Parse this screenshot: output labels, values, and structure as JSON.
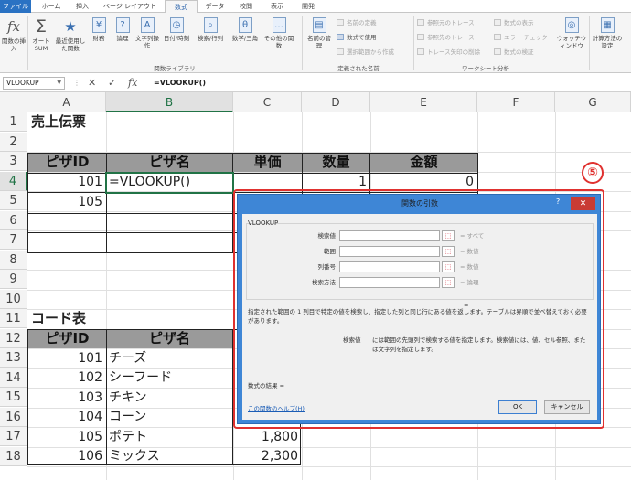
{
  "ribbon": {
    "tabs": [
      "ファイル",
      "ホーム",
      "挿入",
      "ページ レイアウト",
      "数式",
      "データ",
      "校閲",
      "表示",
      "開発"
    ],
    "active_tab": "数式",
    "buttons": {
      "insert_function": "関数の挿入",
      "autosum": "オート SUM",
      "recent": "最近使用した関数",
      "financial": "財務",
      "logical": "論理",
      "text": "文字列操作",
      "datetime": "日付/時刻",
      "lookup": "検索/行列",
      "math": "数学/三角",
      "more": "その他の関数",
      "name_manager": "名前の管理",
      "watch_window": "ウォッチウィンドウ",
      "calc_options": "計算方法の設定"
    },
    "small_commands": {
      "define_name": "名前の定義",
      "use_in_formula": "数式で使用",
      "create_from_selection": "選択範囲から作成",
      "trace_precedents": "参照元のトレース",
      "trace_dependents": "参照先のトレース",
      "remove_arrows": "トレース矢印の削除",
      "show_formulas": "数式の表示",
      "error_check": "エラー チェック",
      "evaluate_formula": "数式の検証"
    },
    "groups": {
      "function_library": "関数ライブラリ",
      "defined_names": "定義された名前",
      "formula_auditing": "ワークシート分析"
    }
  },
  "formula_bar": {
    "name_box": "VLOOKUP",
    "formula": "=VLOOKUP()"
  },
  "grid": {
    "columns": [
      "A",
      "B",
      "C",
      "D",
      "E",
      "F",
      "G"
    ],
    "rows": [
      "1",
      "2",
      "3",
      "4",
      "5",
      "6",
      "7",
      "8",
      "9",
      "10",
      "11",
      "12",
      "13",
      "14",
      "15",
      "16",
      "17",
      "18"
    ],
    "sales_title": "売上伝票",
    "sales_headers": [
      "ピザID",
      "ピザ名",
      "単価",
      "数量",
      "金額"
    ],
    "sales_rows": [
      {
        "id": "101",
        "name_formula": "=VLOOKUP()",
        "qty": "1",
        "amount": "0"
      },
      {
        "id": "105"
      }
    ],
    "code_title": "コード表",
    "code_headers": [
      "ピザID",
      "ピザ名"
    ],
    "code_rows": [
      {
        "id": "101",
        "name": "チーズ"
      },
      {
        "id": "102",
        "name": "シーフード"
      },
      {
        "id": "103",
        "name": "チキン"
      },
      {
        "id": "104",
        "name": "コーン"
      },
      {
        "id": "105",
        "name": "ポテト",
        "price": "1,800"
      },
      {
        "id": "106",
        "name": "ミックス",
        "price": "2,300"
      }
    ]
  },
  "callout": "⑤",
  "dialog": {
    "title": "関数の引数",
    "help": "?",
    "close": "✕",
    "function_name": "VLOOKUP",
    "args": [
      {
        "label": "検索値",
        "result": "= すべて"
      },
      {
        "label": "範囲",
        "result": "= 数値"
      },
      {
        "label": "列番号",
        "result": "= 数値"
      },
      {
        "label": "検索方法",
        "result": "= 論理"
      }
    ],
    "result_eq": "=",
    "description": "指定された範囲の 1 列目で特定の値を検索し、指定した列と同じ行にある値を返します。テーブルは昇順で並べ替えておく必要があります。",
    "arg_name": "検索値",
    "arg_description": "には範囲の先頭列で検索する値を指定します。検索値には、値、セル参照、または文字列を指定します。",
    "calc_result": "数式の結果 =",
    "help_link": "この関数のヘルプ(H)",
    "ok": "OK",
    "cancel": "キャンセル"
  }
}
